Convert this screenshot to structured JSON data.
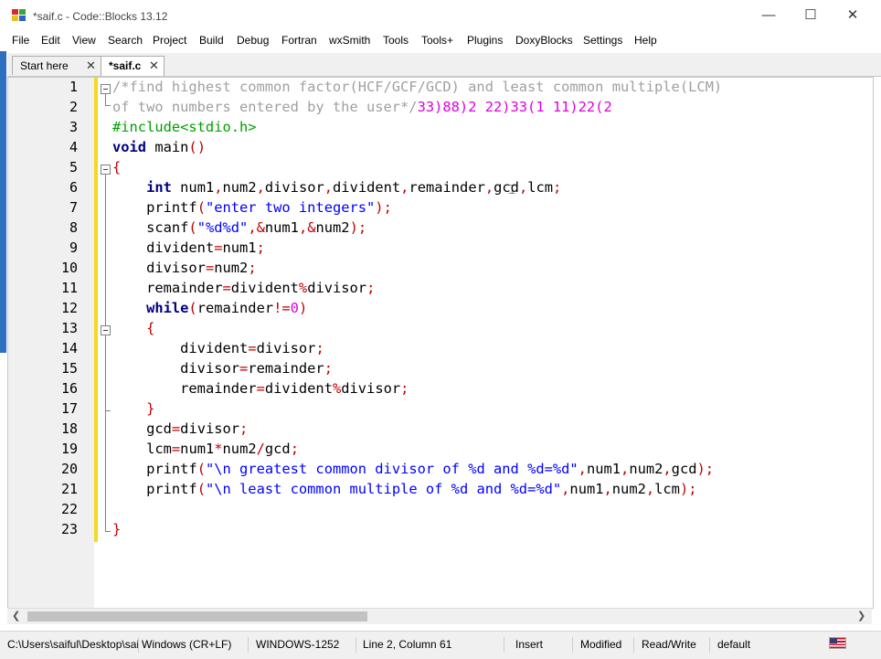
{
  "window": {
    "title": "*saif.c - Code::Blocks 13.12"
  },
  "menu": [
    "File",
    "Edit",
    "View",
    "Search",
    "Project",
    "Build",
    "Debug",
    "Fortran",
    "wxSmith",
    "Tools",
    "Tools+",
    "Plugins",
    "DoxyBlocks",
    "Settings",
    "Help"
  ],
  "tabs": [
    {
      "label": "Start here",
      "active": false
    },
    {
      "label": "*saif.c",
      "active": true
    }
  ],
  "editor": {
    "line_numbers": [
      "1",
      "2",
      "3",
      "4",
      "5",
      "6",
      "7",
      "8",
      "9",
      "10",
      "11",
      "12",
      "13",
      "14",
      "15",
      "16",
      "17",
      "18",
      "19",
      "20",
      "21",
      "22",
      "23"
    ]
  },
  "code": {
    "l1": {
      "t1": "/*find highest common factor(HCF/GCF/GCD) and least common multiple(LCM)"
    },
    "l2": {
      "t1": "of two numbers entered by the user*/",
      "t2": "33)",
      "t3": "88)2 22)33(1 11)22(2"
    },
    "l3": {
      "t1": "#include<stdio.h>"
    },
    "l4": {
      "t1": "void",
      "t2": " main",
      "t3": "()"
    },
    "l5": {
      "t1": "{"
    },
    "l6": {
      "t1": "int",
      "t2": " num1",
      "t3": ",",
      "t4": "num2",
      "t5": ",",
      "t6": "divisor",
      "t7": ",",
      "t8": "divident",
      "t9": ",",
      "t10": "remainder",
      "t11": ",",
      "t12": "gcd",
      "t13": ",",
      "t14": "lcm",
      "t15": ";"
    },
    "l7": {
      "t1": "printf",
      "t2": "(",
      "t3": "\"enter two integers\"",
      "t4": ");"
    },
    "l8": {
      "t1": "scanf",
      "t2": "(",
      "t3": "\"%d%d\"",
      "t4": ",&",
      "t5": "num1",
      "t6": ",&",
      "t7": "num2",
      "t8": ");"
    },
    "l9": {
      "t1": "divident",
      "t2": "=",
      "t3": "num1",
      "t4": ";"
    },
    "l10": {
      "t1": "divisor",
      "t2": "=",
      "t3": "num2",
      "t4": ";"
    },
    "l11": {
      "t1": "remainder",
      "t2": "=",
      "t3": "divident",
      "t4": "%",
      "t5": "divisor",
      "t6": ";"
    },
    "l12": {
      "t1": "while",
      "t2": "(",
      "t3": "remainder",
      "t4": "!=",
      "t5": "0",
      "t6": ")"
    },
    "l13": {
      "t1": "{"
    },
    "l14": {
      "t1": "divident",
      "t2": "=",
      "t3": "divisor",
      "t4": ";"
    },
    "l15": {
      "t1": "divisor",
      "t2": "=",
      "t3": "remainder",
      "t4": ";"
    },
    "l16": {
      "t1": "remainder",
      "t2": "=",
      "t3": "divident",
      "t4": "%",
      "t5": "divisor",
      "t6": ";"
    },
    "l17": {
      "t1": "}"
    },
    "l18": {
      "t1": "gcd",
      "t2": "=",
      "t3": "divisor",
      "t4": ";"
    },
    "l19": {
      "t1": "lcm",
      "t2": "=",
      "t3": "num1",
      "t4": "*",
      "t5": "num2",
      "t6": "/",
      "t7": "gcd",
      "t8": ";"
    },
    "l20": {
      "t1": "printf",
      "t2": "(",
      "t3": "\"\\n greatest common divisor of %d and %d=%d\"",
      "t4": ",",
      "t5": "num1",
      "t6": ",",
      "t7": "num2",
      "t8": ",",
      "t9": "gcd",
      "t10": ");"
    },
    "l21": {
      "t1": "printf",
      "t2": "(",
      "t3": "\"\\n least common multiple of %d and %d=%d\"",
      "t4": ",",
      "t5": "num1",
      "t6": ",",
      "t7": "num2",
      "t8": ",",
      "t9": "lcm",
      "t10": ");"
    },
    "l22": {
      "t1": ""
    },
    "l23": {
      "t1": "}"
    }
  },
  "statusbar": {
    "path": "C:\\Users\\saiful\\Desktop\\saif.c",
    "line_endings": "Windows (CR+LF)",
    "encoding": "WINDOWS-1252",
    "position": "Line 2, Column 61",
    "mode": "Insert",
    "modified": "Modified",
    "access": "Read/Write",
    "profile": "default"
  }
}
